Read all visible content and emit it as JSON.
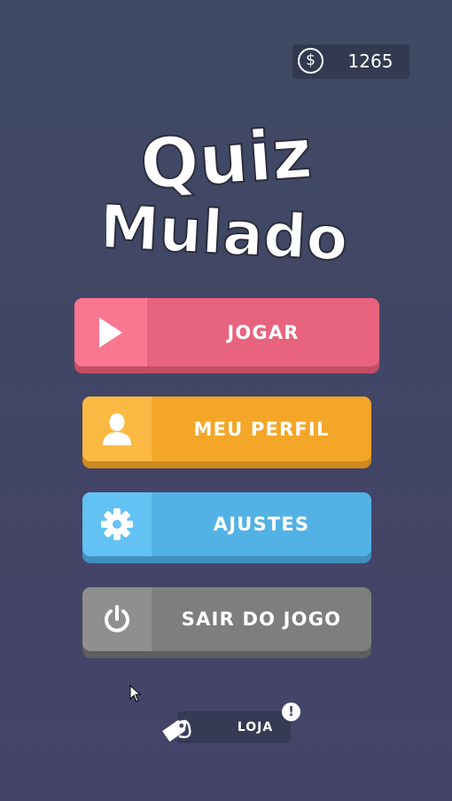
{
  "currency": {
    "icon": "dollar-coin-icon",
    "symbol": "$",
    "amount": "1265"
  },
  "logo": {
    "line1": "Quiz",
    "line2": "Mulado"
  },
  "menu": [
    {
      "id": "play",
      "label": "JOGAR",
      "icon": "play-icon",
      "color": "#e8647e",
      "icon_bg": "#fa7790",
      "shadow": "#c34e66"
    },
    {
      "id": "profile",
      "label": "MEU PERFIL",
      "icon": "user-icon",
      "color": "#f4a628",
      "icon_bg": "#fbb944",
      "shadow": "#cf8a1d"
    },
    {
      "id": "settings",
      "label": "AJUSTES",
      "icon": "gear-icon",
      "color": "#53b2e5",
      "icon_bg": "#62c2f4",
      "shadow": "#3f8fbf"
    },
    {
      "id": "quit",
      "label": "SAIR DO JOGO",
      "icon": "power-icon",
      "color": "#7e7e7e",
      "icon_bg": "#8f8f8f",
      "shadow": "#5e5e5e"
    }
  ],
  "shop": {
    "label": "LOJA",
    "icon": "shop-tag-icon",
    "alert": "!"
  }
}
